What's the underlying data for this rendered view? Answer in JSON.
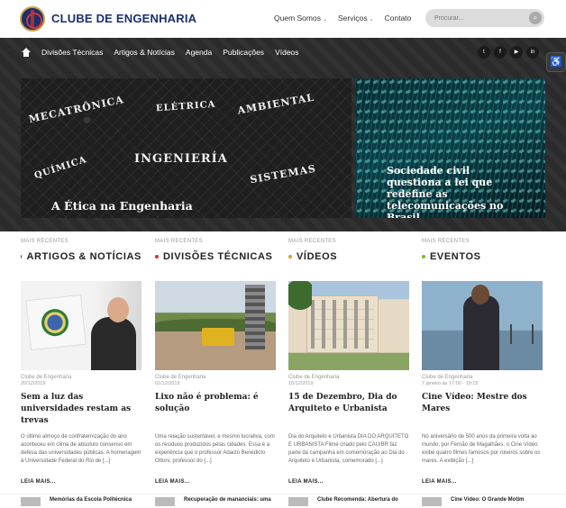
{
  "header": {
    "brand": "CLUBE DE ENGENHARIA",
    "nav": [
      {
        "label": "Quem Somos",
        "has_caret": true
      },
      {
        "label": "Serviços",
        "has_caret": true
      },
      {
        "label": "Contato",
        "has_caret": false
      }
    ],
    "search_placeholder": "Procurar..."
  },
  "subnav": {
    "items": [
      "Divisões Técnicas",
      "Artigos & Notícias",
      "Agenda",
      "Publicações",
      "Vídeos"
    ],
    "social": [
      "twitter-icon",
      "facebook-icon",
      "youtube-icon",
      "linkedin-icon"
    ],
    "social_glyphs": [
      "t",
      "f",
      "▶",
      "in"
    ]
  },
  "featured": [
    {
      "title": "A Ética na Engenharia",
      "doodle_words": [
        "MECATRÔNICA",
        "ELÉTRICA",
        "AMBIENTAL",
        "INGENIERÍA",
        "QUÍMICA",
        "SISTEMAS"
      ]
    },
    {
      "title": "Sociedade civil questiona a lei que redefine as telecomunicações no Brasil"
    }
  ],
  "columns": [
    {
      "kicker": "MAIS RECENTES",
      "heading": "ARTIGOS & NOTÍCIAS",
      "dot_color": "#2a4fa8",
      "source": "Clube de Engenharia",
      "date": "20/12/2019",
      "title": "Sem a luz das universidades restam as trevas",
      "excerpt": "O último almoço de confraternização do ano aconteceu em clima de absoluto consenso em defesa das universidades públicas. A homenagem à Universidade Federal do Rio de [...]",
      "more": "LEIA MAIS...",
      "related": "Memórias da Escola Politécnica"
    },
    {
      "kicker": "MAIS RECENTES",
      "heading": "DIVISÕES TÉCNICAS",
      "dot_color": "#d9342b",
      "source": "Clube de Engenharia",
      "date": "02/12/2019",
      "title": "Lixo não é problema: é solução",
      "excerpt": "Uma relação sustentável, e mesmo lucrativa, com os resíduos produzidos pelas cidades. Essa é a experiência que o professor Adacto Benedicto Ottoni, professor do [...]",
      "more": "LEIA MAIS...",
      "related": "Recuperação de mananciais: uma"
    },
    {
      "kicker": "MAIS RECENTES",
      "heading": "VÍDEOS",
      "dot_color": "#e0a21f",
      "source": "Clube de Engenharia",
      "date": "16/12/2019",
      "title": "15 de Dezembro, Dia do Arquiteto e Urbanista",
      "excerpt": "Dia do Arquiteto e Urbanista DIA DO ARQUITETO E URBANISTA Filme criado pelo CAU/BR faz parte da campanha em comemoração ao Dia do Arquiteto e Urbanista, comemorado [...]",
      "more": "LEIA MAIS...",
      "related": "Clube Recomenda: Abertura do"
    },
    {
      "kicker": "MAIS RECENTES",
      "heading": "EVENTOS",
      "dot_color": "#7cb82f",
      "source": "Clube de Engenharia",
      "date": "7 janeiro às 17:00 - 19:15",
      "title": "Cine Vídeo: Mestre dos Mares",
      "excerpt": "No aniversário de 500 anos da primeira volta ao mundo, por Fernão de Magalhães, o Cine Vídeo exibe quatro filmes famosos por roteiros sobre os mares. A exibição [...]",
      "more": "LEIA MAIS...",
      "related": "Cine Vídeo: O Grande Motim"
    }
  ]
}
